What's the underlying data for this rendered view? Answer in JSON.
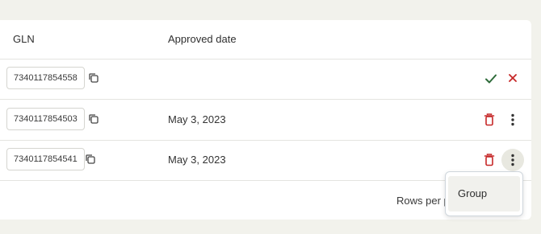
{
  "table": {
    "columns": {
      "gln": "GLN",
      "approved_date": "Approved date"
    },
    "rows": [
      {
        "gln": "7340117854558",
        "approved_date": "",
        "state": "pending"
      },
      {
        "gln": "7340117854503",
        "approved_date": "May 3, 2023",
        "state": "approved"
      },
      {
        "gln": "7340117854541",
        "approved_date": "May 3, 2023",
        "state": "approved"
      }
    ],
    "footer": {
      "rows_per_page_label": "Rows per page"
    }
  },
  "row_menu": {
    "items": [
      "Group"
    ]
  },
  "colors": {
    "approve": "#2e6b3a",
    "reject": "#c62828",
    "delete": "#c62828",
    "page_bg": "#f2f2ec"
  },
  "icons": {
    "copy": "copy-icon",
    "approve": "checkmark-icon",
    "reject": "close-icon",
    "delete": "trash-icon",
    "more": "more-vertical-icon"
  }
}
